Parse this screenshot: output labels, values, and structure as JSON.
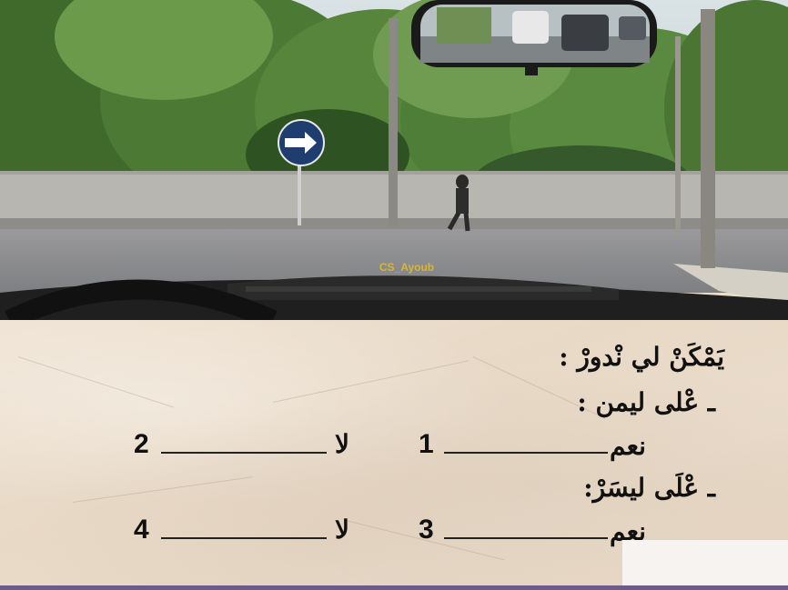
{
  "photo": {
    "dashboard_text": "CS_Ayoub"
  },
  "quiz": {
    "question": "يَمْكَنْ لي نْدورْ :",
    "section_right": {
      "heading": "ـ عْلى ليمن :",
      "yes_label": "نعم",
      "yes_number": "1",
      "no_label": "لا",
      "no_number": "2"
    },
    "section_left": {
      "heading": "ـ عْلَى ليسَرْ:",
      "yes_label": "نعم",
      "yes_number": "3",
      "no_label": "لا",
      "no_number": "4"
    }
  }
}
